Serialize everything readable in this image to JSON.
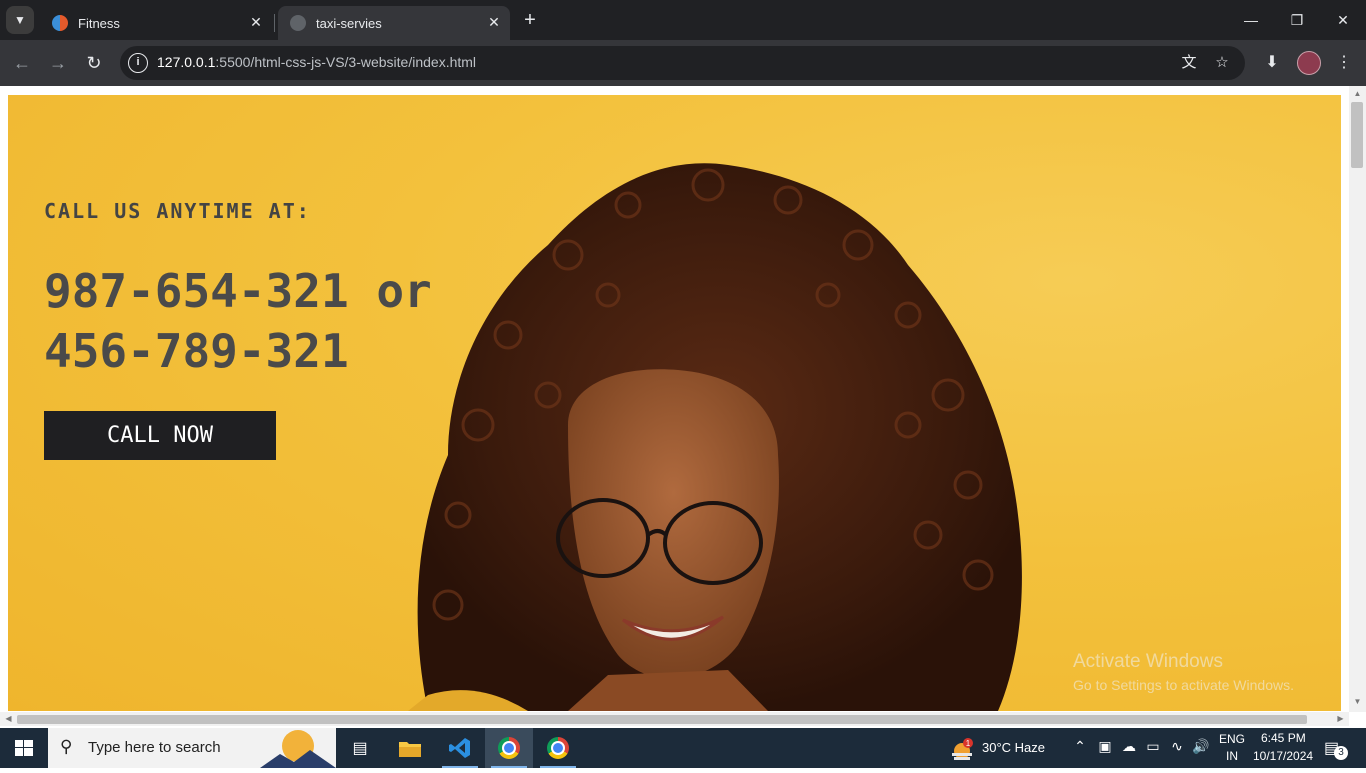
{
  "browser": {
    "tabs": [
      {
        "title": "Fitness",
        "active": false
      },
      {
        "title": "taxi-servies",
        "active": true
      }
    ],
    "url_host": "127.0.0.1",
    "url_rest": ":5500/html-css-js-VS/3-website/index.html",
    "icons": {
      "tab_search": "chevron-down-icon",
      "close": "close-icon",
      "new_tab": "plus-icon",
      "back": "arrow-left-icon",
      "forward": "arrow-right-icon",
      "reload": "reload-icon",
      "site_info": "info-icon",
      "translate": "translate-icon",
      "bookmark": "star-icon",
      "download": "download-icon",
      "menu": "kebab-menu-icon"
    }
  },
  "page": {
    "kicker": "CALL US ANYTIME AT:",
    "phone_line1": "987-654-321 or",
    "phone_line2": "456-789-321",
    "cta_label": "CALL NOW",
    "background_color": "#f3c13c",
    "button_color": "#1f1f22",
    "text_color": "#4a4a4a"
  },
  "watermark": {
    "title": "Activate Windows",
    "subtitle": "Go to Settings to activate Windows."
  },
  "taskbar": {
    "search_placeholder": "Type here to search",
    "weather": "30°C  Haze",
    "weather_badge": "1",
    "language_top": "ENG",
    "language_bottom": "IN",
    "time": "6:45 PM",
    "date": "10/17/2024",
    "notifications": "3"
  }
}
